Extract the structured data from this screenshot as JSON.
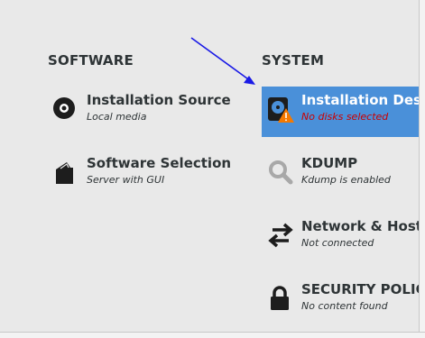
{
  "software": {
    "heading": "SOFTWARE",
    "items": [
      {
        "label": "Installation Source",
        "status": "Local media",
        "icon": "disc-icon"
      },
      {
        "label": "Software Selection",
        "status": "Server with GUI",
        "icon": "package-icon"
      }
    ]
  },
  "system": {
    "heading": "SYSTEM",
    "items": [
      {
        "label": "Installation Destination",
        "status": "No disks selected",
        "icon": "harddisk-warning-icon"
      },
      {
        "label": "KDUMP",
        "status": "Kdump is enabled",
        "icon": "magnifier-icon"
      },
      {
        "label": "Network & Host Name",
        "status": "Not connected",
        "icon": "network-arrows-icon"
      },
      {
        "label": "SECURITY POLICY",
        "status": "No content found",
        "icon": "lock-icon"
      }
    ]
  },
  "colors": {
    "selected_bg": "#4a90d9",
    "warning_text": "#cc0000",
    "annotation_arrow": "#1a1ae6"
  }
}
